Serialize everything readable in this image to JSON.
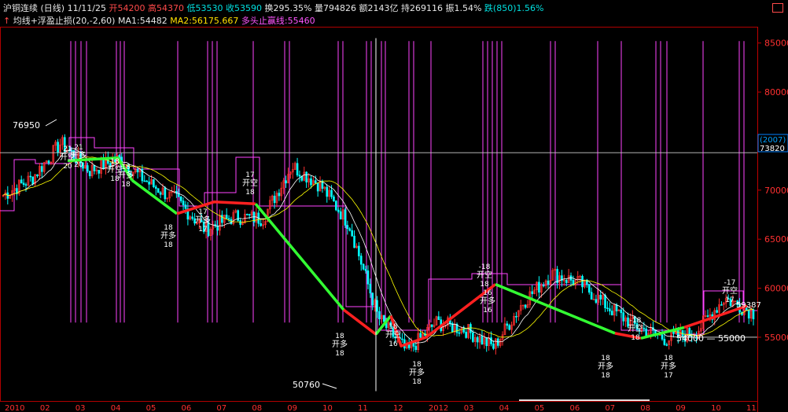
{
  "header": {
    "name": "沪铜连续",
    "period": "(日线)",
    "date": "11/11/25",
    "open": "开54200",
    "high": "高54370",
    "low": "低53530",
    "close": "收53590",
    "turnover": "换295.35%",
    "volume": "量794826",
    "amount": "额2143亿",
    "oi": "持269116",
    "amplitude": "振1.54%",
    "change": "跌(850)1.56%",
    "indicator": "均线+浮盈止损(20,-2,60)",
    "ma1": "MA1:54482",
    "ma2": "MA2:56175.667",
    "stop_line": "多头止赢线:55460"
  },
  "colors": {
    "up": "#ff3030",
    "down": "#00ffff",
    "ma1": "#ffffff",
    "ma2": "#ffff00",
    "stop": "#ff44ff",
    "trend_up": "#ff2020",
    "trend_down": "#33ff33"
  },
  "chart_data": {
    "type": "line",
    "title": "沪铜连续 (日线)",
    "y_axis": {
      "ylim": [
        48500,
        86500
      ],
      "ticks": [
        "55000",
        "60000",
        "65000",
        "70000",
        "75000",
        "80000",
        "85000"
      ]
    },
    "x_axis": {
      "labels": [
        "2010",
        "02",
        "03",
        "04",
        "05",
        "06",
        "07",
        "08",
        "09",
        "10",
        "11",
        "12",
        "2012",
        "03",
        "04",
        "05",
        "06",
        "07",
        "08",
        "09",
        "10",
        "11"
      ]
    },
    "price_series": [
      [
        "2010-01",
        69500
      ],
      [
        "2010-02",
        71200
      ],
      [
        "2010-03",
        74800
      ],
      [
        "2010-03b",
        72000
      ],
      [
        "2010-04",
        73200
      ],
      [
        "2010-04b",
        70800
      ],
      [
        "2010-05",
        69000
      ],
      [
        "2010-06",
        66000
      ],
      [
        "2010-07",
        67300
      ],
      [
        "2010-07b",
        67100
      ],
      [
        "2010-08",
        72500
      ],
      [
        "2010-09",
        70500
      ],
      [
        "2010-10",
        66500
      ],
      [
        "2010-11",
        57000
      ],
      [
        "2010-11b",
        53500
      ],
      [
        "2010-12",
        56500
      ],
      [
        "2011-01",
        55800
      ],
      [
        "2011-02",
        54000
      ],
      [
        "2011-03",
        58500
      ],
      [
        "2011-04",
        61500
      ],
      [
        "2011-05",
        60500
      ],
      [
        "2011-06",
        58000
      ],
      [
        "2011-07",
        56000
      ],
      [
        "2011-08",
        54800
      ],
      [
        "2011-09",
        55500
      ],
      [
        "2011-10",
        59000
      ],
      [
        "2011-11",
        57500
      ]
    ],
    "trend_segments": [
      {
        "dir": "down",
        "points": [
          [
            86,
            73000
          ],
          [
            150,
            73300
          ],
          [
            168,
            71000
          ]
        ]
      },
      {
        "dir": "down",
        "points": [
          [
            168,
            71000
          ],
          [
            225,
            67600
          ]
        ]
      },
      {
        "dir": "up",
        "points": [
          [
            225,
            67600
          ],
          [
            272,
            68800
          ],
          [
            325,
            68600
          ]
        ]
      },
      {
        "dir": "down",
        "points": [
          [
            325,
            68600
          ],
          [
            437,
            57800
          ]
        ]
      },
      {
        "dir": "up",
        "points": [
          [
            437,
            57800
          ],
          [
            478,
            55300
          ]
        ]
      },
      {
        "dir": "down",
        "points": [
          [
            478,
            55300
          ],
          [
            497,
            57200
          ]
        ]
      },
      {
        "dir": "up",
        "points": [
          [
            497,
            57200
          ],
          [
            510,
            54100
          ],
          [
            542,
            55000
          ],
          [
            630,
            60400
          ]
        ]
      },
      {
        "dir": "down",
        "points": [
          [
            630,
            60400
          ],
          [
            782,
            55400
          ]
        ]
      },
      {
        "dir": "up",
        "points": [
          [
            782,
            55400
          ],
          [
            815,
            54900
          ]
        ]
      },
      {
        "dir": "down",
        "points": [
          [
            815,
            54900
          ],
          [
            870,
            56000
          ]
        ]
      },
      {
        "dir": "up",
        "points": [
          [
            870,
            56000
          ],
          [
            950,
            58200
          ]
        ]
      }
    ],
    "annotations": [
      {
        "text": "76950",
        "role": "high"
      },
      {
        "text": "50760",
        "role": "low"
      },
      {
        "text": "(2007)",
        "role": "cursor-count"
      },
      {
        "text": "73820",
        "role": "cursor-price"
      },
      {
        "text": "54000 — 55000",
        "role": "range"
      },
      {
        "text": "59387",
        "role": "last-label"
      }
    ],
    "cursor_price": 73820,
    "range_line": 55000
  },
  "marker_labels": {
    "buy": "开多",
    "sell": "开空",
    "n18": "18",
    "n17": "17",
    "n16": "16",
    "n21": "21",
    "n20": "20",
    "m18": "-18",
    "m17": "-17"
  }
}
